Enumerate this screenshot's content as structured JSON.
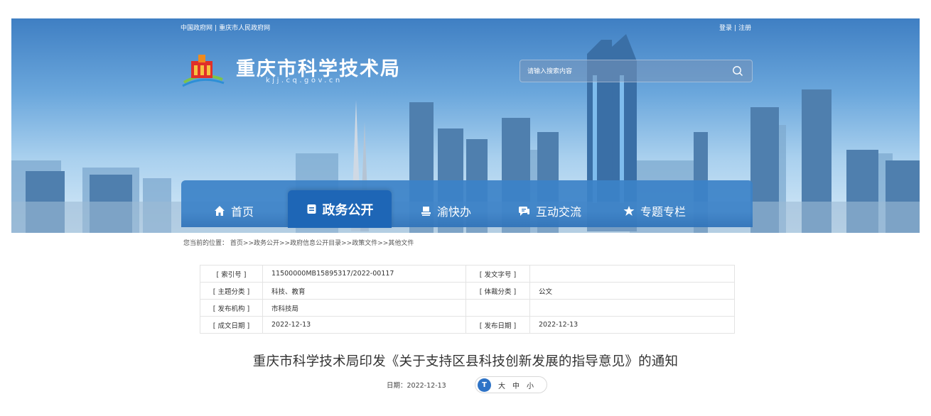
{
  "header": {
    "top_links": [
      "中国政府网",
      "重庆市人民政府网"
    ],
    "user_links": [
      "登录",
      "注册"
    ],
    "site_title": "重庆市科学技术局",
    "site_domain": "kjj.cq.gov.cn",
    "search_placeholder": "请输入搜索内容",
    "link_separator": "|"
  },
  "nav": {
    "items": [
      {
        "label": "首页",
        "icon": "home-icon"
      },
      {
        "label": "政务公开",
        "icon": "document-icon",
        "active": true
      },
      {
        "label": "渝快办",
        "icon": "stamp-icon"
      },
      {
        "label": "互动交流",
        "icon": "chat-icon"
      },
      {
        "label": "专题专栏",
        "icon": "star-icon"
      }
    ]
  },
  "breadcrumb": {
    "prefix": "您当前的位置：",
    "items": [
      "首页",
      "政务公开",
      "政府信息公开目录",
      "政策文件",
      "其他文件"
    ],
    "separator": ">>"
  },
  "meta": {
    "rows": [
      [
        "[ 索引号 ]",
        "11500000MB15895317/2022-00117",
        "[ 发文字号 ]",
        ""
      ],
      [
        "[ 主题分类 ]",
        "科技、教育",
        "[ 体裁分类 ]",
        "公文"
      ],
      [
        "[ 发布机构 ]",
        "市科技局",
        "",
        ""
      ],
      [
        "[ 成文日期 ]",
        "2022-12-13",
        "[ 发布日期 ]",
        "2022-12-13"
      ]
    ]
  },
  "article": {
    "title": "重庆市科学技术局印发《关于支持区县科技创新发展的指导意见》的通知",
    "date": "日期：2022-12-13",
    "font_icon_text": "T",
    "font_sizes": [
      "大",
      "中",
      "小"
    ]
  },
  "colors": {
    "nav_bg": "#3c82c8",
    "nav_active": "#1e66b6",
    "font_icon": "#2e73c6"
  }
}
